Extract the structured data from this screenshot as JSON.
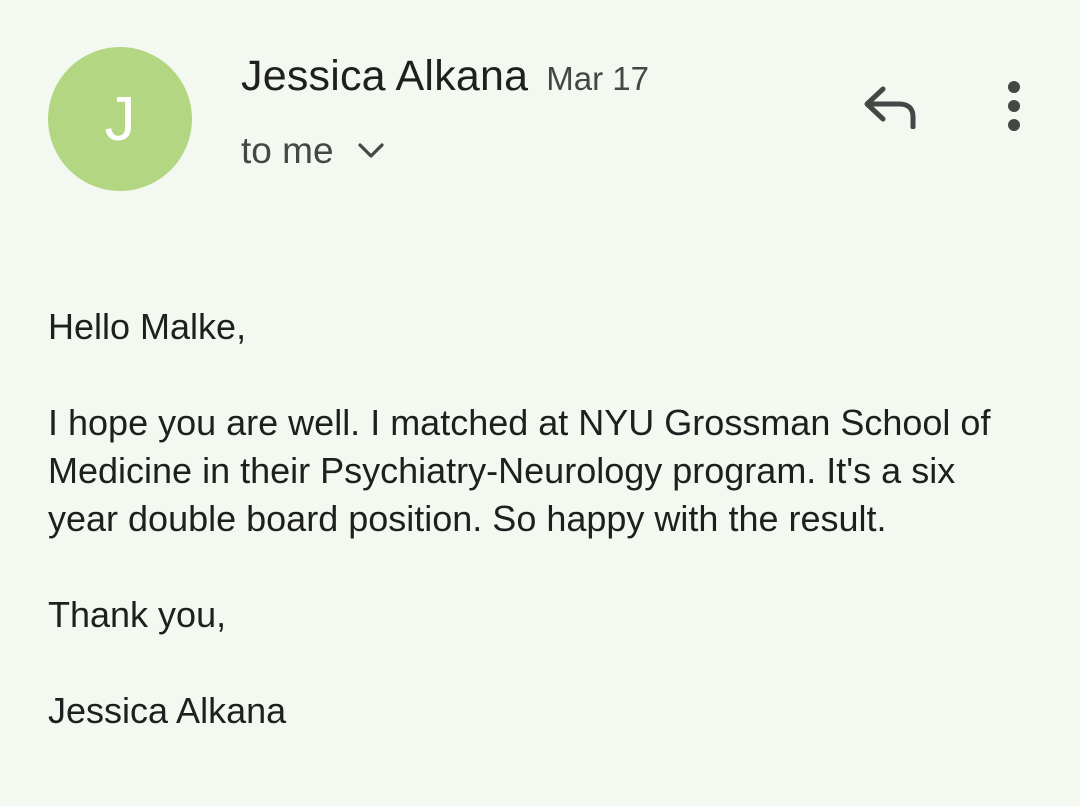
{
  "email": {
    "sender": {
      "avatar_initial": "J",
      "avatar_color": "#b2d681",
      "name": "Jessica Alkana",
      "date": "Mar 17"
    },
    "recipient_summary": "to me",
    "icons": {
      "reply": "reply-icon",
      "more": "more-vert-icon",
      "expand": "chevron-down-icon"
    },
    "body": {
      "greeting": "Hello Malke,",
      "paragraph": "I hope you are well. I matched at NYU Grossman School of Medicine in their Psychiatry-Neurology program. It's a six year double board position. So happy with the result.",
      "closing": "Thank you,",
      "signature": "Jessica Alkana"
    }
  }
}
